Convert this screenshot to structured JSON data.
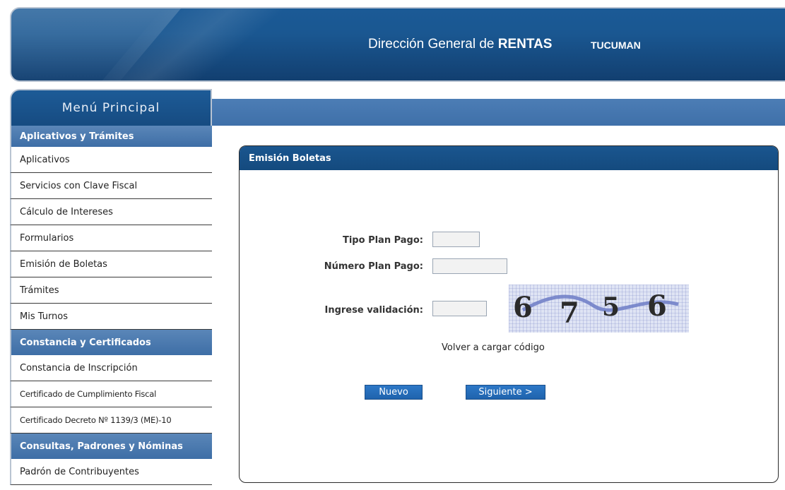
{
  "header": {
    "title_prefix": "Dirección General de ",
    "title_strong": "RENTAS",
    "region": "TUCUMAN"
  },
  "sidebar": {
    "menu_title": "Menú Principal",
    "sections": [
      {
        "title": "Aplicativos y Trámites",
        "items": [
          "Aplicativos",
          "Servicios con Clave Fiscal",
          "Cálculo de Intereses",
          "Formularios",
          "Emisión de Boletas",
          "Trámites",
          "Mis Turnos"
        ]
      },
      {
        "title": "Constancia y Certificados",
        "items": [
          "Constancia de Inscripción",
          "Certificado de Cumplimiento Fiscal",
          "Certificado Decreto Nº 1139/3 (ME)-10"
        ]
      },
      {
        "title": "Consultas, Padrones y Nóminas",
        "items": [
          "Padrón de Contribuyentes"
        ]
      }
    ]
  },
  "panel": {
    "title": "Emisión Boletas",
    "fields": {
      "tipo_plan_label": "Tipo Plan Pago:",
      "tipo_plan_value": "",
      "numero_plan_label": "Número Plan Pago:",
      "numero_plan_value": "",
      "validacion_label": "Ingrese validación:",
      "validacion_value": ""
    },
    "captcha_text": "6756",
    "reload_link": "Volver a cargar código",
    "buttons": {
      "nuevo": "Nuevo",
      "siguiente": "Siguiente >"
    }
  },
  "colors": {
    "header_blue": "#1a5791",
    "section_blue": "#4a7ab0",
    "button_blue": "#2569b5"
  }
}
